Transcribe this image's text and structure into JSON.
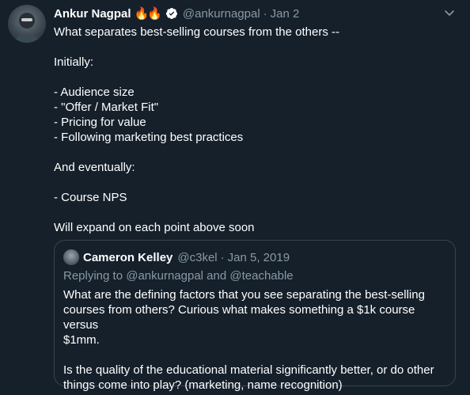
{
  "tweet": {
    "author_name": "Ankur Nagpal",
    "author_emoji": "🔥🔥",
    "handle": "@ankurnagpal",
    "separator": "·",
    "date": "Jan 2",
    "lines": [
      "What separates best-selling courses from the others --",
      "",
      "Initially:",
      "",
      "- Audience size",
      "- \"Offer / Market Fit\"",
      "- Pricing for value",
      "- Following marketing best practices",
      "",
      "And eventually:",
      "",
      "- Course NPS",
      "",
      "Will expand on each point above soon"
    ]
  },
  "quoted_tweet": {
    "author_name": "Cameron Kelley",
    "handle": "@c3kel",
    "separator": "·",
    "date": "Jan 5, 2019",
    "reply_context": "Replying to @ankurnagpal and @teachable",
    "lines": [
      "What are the defining factors that you see separating the best-selling",
      "courses from others? Curious what makes something a $1k course versus",
      "$1mm.",
      "",
      "Is the quality of the educational material significantly better, or do other",
      "things come into play? (marketing, name recognition)"
    ]
  },
  "colors": {
    "background": "#15202b",
    "secondary_text": "#8899a6",
    "border": "#38444d",
    "verified_badge": "#ffffff"
  },
  "icons": [
    "avatar",
    "verified-badge-icon",
    "chevron-down-icon",
    "quoted-avatar"
  ]
}
